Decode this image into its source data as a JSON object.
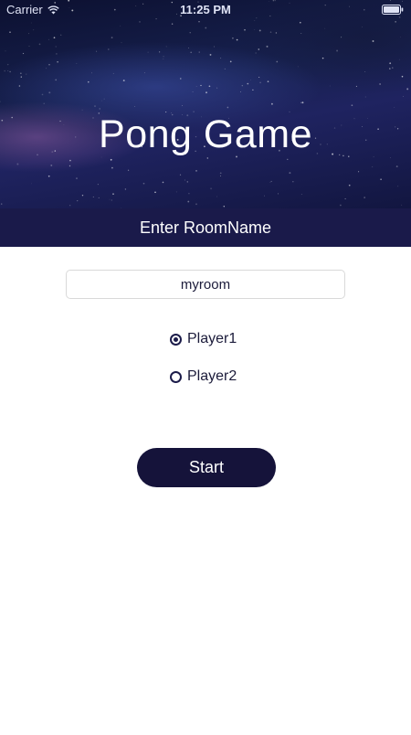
{
  "status_bar": {
    "carrier": "Carrier",
    "time": "11:25 PM",
    "wifi_icon": "wifi-icon",
    "battery_icon": "battery-icon"
  },
  "header": {
    "title": "Pong Game",
    "background": "starry-nebula"
  },
  "room_banner": {
    "label": "Enter RoomName",
    "color": "#1a1a4a"
  },
  "room_input": {
    "value": "myroom",
    "placeholder": ""
  },
  "players": {
    "selected": "Player1",
    "options": [
      {
        "label": "Player1",
        "checked": true
      },
      {
        "label": "Player2",
        "checked": false
      }
    ]
  },
  "start_button": {
    "label": "Start",
    "color": "#15133a"
  }
}
